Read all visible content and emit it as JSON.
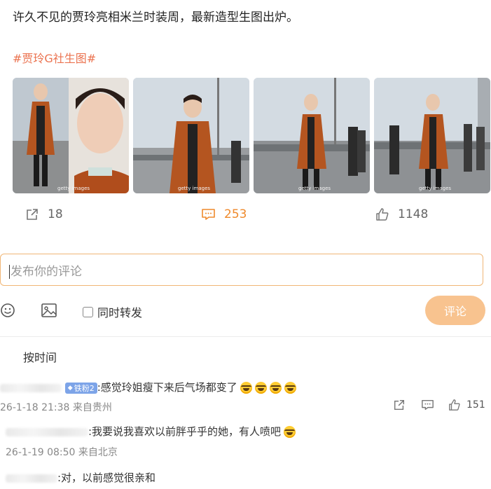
{
  "post": {
    "text": "许久不见的贾玲亮相米兰时装周，最新造型生图出炉。",
    "hashtag": "#贾玲G社生图#"
  },
  "photos": [
    {
      "watermark": "getty images"
    },
    {
      "watermark": "getty images"
    },
    {
      "watermark": "getty images"
    },
    {
      "watermark": "getty images"
    }
  ],
  "actions": {
    "repost_count": "18",
    "comment_count": "253",
    "like_count": "1148"
  },
  "composer": {
    "placeholder": "发布你的评论",
    "also_repost_label": "同时转发",
    "submit_label": "评论"
  },
  "sort_label": "按时间",
  "comments": [
    {
      "badge": "铁粉2",
      "text": ":感觉玲姐瘦下来后气场都变了",
      "meta": "26-1-18 21:38 来自贵州",
      "likes": "151"
    },
    {
      "text": ":我要说我喜欢以前胖乎乎的她，有人喷吧",
      "meta": "26-1-19 08:50 来自北京"
    },
    {
      "text": ":对，以前感觉很亲和"
    }
  ],
  "colors": {
    "accent": "#eb7350",
    "comment_active": "#ef8a2c",
    "submit_bg": "#f8c38f",
    "input_border": "#f0b676"
  }
}
